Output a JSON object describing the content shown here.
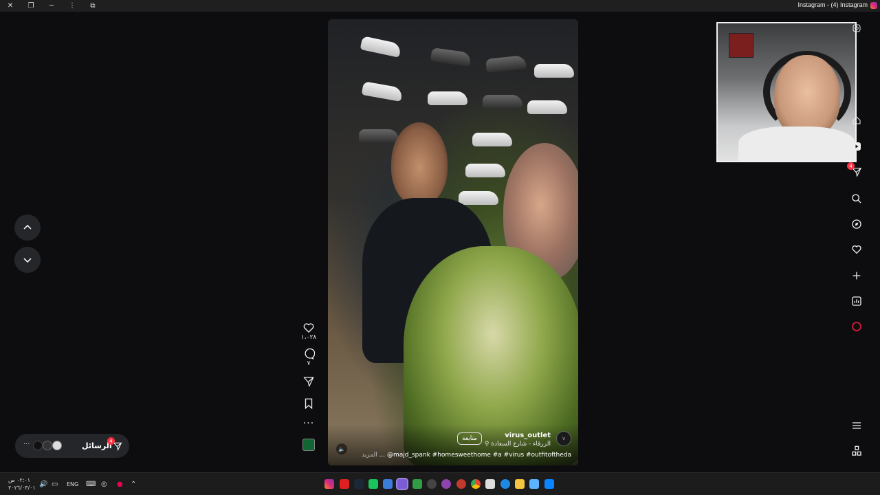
{
  "window": {
    "title": "Instagram - (4) Instagram"
  },
  "post": {
    "likes": "١،٠٢٨",
    "comments": "٧",
    "username": "virus_outlet",
    "location": "الزرقاء - شارع السعادة",
    "follow_label": "متابعة",
    "caption": "@majd_spank #homesweethome #a #virus #outfitoftheda",
    "more_label": "المزيد",
    "avatar_text": "V"
  },
  "sidebar": {
    "notifications_badge": "4"
  },
  "messages": {
    "label": "الرسائل",
    "badge": "4"
  },
  "taskbar": {
    "time": "٠٢:٠١ ص",
    "date": "٢٠٢٦/٠٣/٠١",
    "language": "ENG"
  },
  "colors": {
    "badge": "#ff3040",
    "background": "#0d0d0f",
    "panel": "#25262a"
  }
}
